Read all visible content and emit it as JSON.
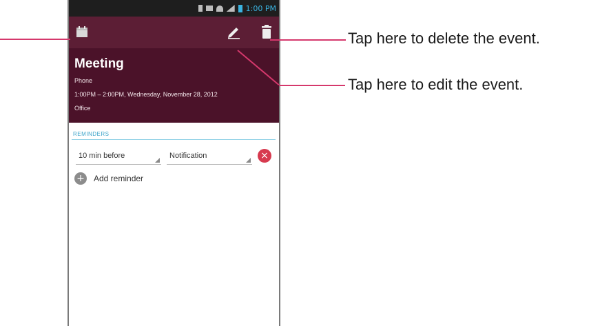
{
  "status_bar": {
    "time": "1:00 PM"
  },
  "icons": {
    "calendar": "calendar-icon",
    "edit": "pencil-icon",
    "delete": "trash-icon",
    "remove": "remove-icon",
    "add": "plus-icon"
  },
  "colors": {
    "action_bar": "#5c1e35",
    "event_header": "#4b1229",
    "reminders_accent": "#3aa3c9",
    "remove_button": "#d73a4f",
    "callout_line": "#d5386c"
  },
  "event": {
    "title": "Meeting",
    "calendar": "Phone",
    "time": "1:00PM – 2:00PM, Wednesday, November 28, 2012",
    "location": "Office"
  },
  "reminders": {
    "label": "REMINDERS",
    "items": [
      {
        "time": "10 min before",
        "type": "Notification"
      }
    ],
    "add_label": "Add reminder"
  },
  "callouts": {
    "delete": "Tap here to delete the event.",
    "edit": "Tap here to edit the event."
  }
}
